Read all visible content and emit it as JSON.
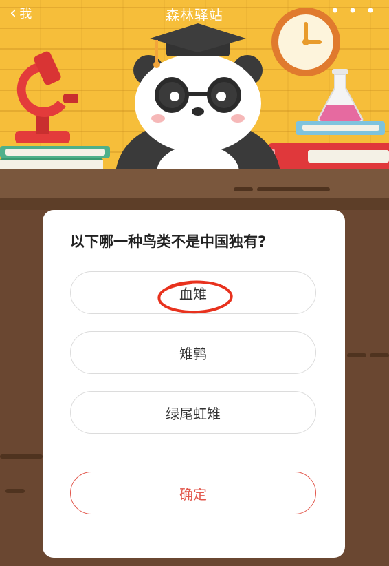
{
  "header": {
    "back_label": "我",
    "title": "森林驿站",
    "more_label": "• • •"
  },
  "quiz": {
    "question": "以下哪一种鸟类不是中国独有?",
    "options": [
      "血雉",
      "雉鹑",
      "绿尾虹雉"
    ],
    "confirm_label": "确定"
  },
  "colors": {
    "wall": "#f6be3a",
    "desk": "#6a4731",
    "accent_red": "#e2574c"
  }
}
